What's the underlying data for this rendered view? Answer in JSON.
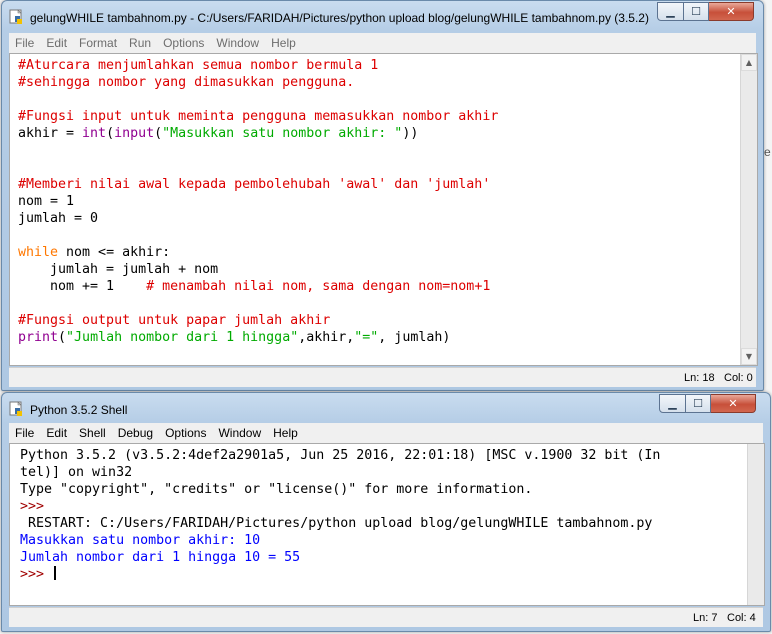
{
  "editor_window": {
    "title": "gelungWHILE tambahnom.py - C:/Users/FARIDAH/Pictures/python upload blog/gelungWHILE tambahnom.py (3.5.2)",
    "menu": [
      "File",
      "Edit",
      "Format",
      "Run",
      "Options",
      "Window",
      "Help"
    ],
    "code_lines": [
      [
        {
          "t": "#Aturcara menjumlahkan semua nombor bermula 1",
          "c": "cmt"
        }
      ],
      [
        {
          "t": "#sehingga nombor yang dimasukkan pengguna.",
          "c": "cmt"
        }
      ],
      [],
      [
        {
          "t": "#Fungsi input untuk meminta pengguna memasukkan nombor akhir",
          "c": "cmt"
        }
      ],
      [
        {
          "t": "akhir = ",
          "c": ""
        },
        {
          "t": "int",
          "c": "bi"
        },
        {
          "t": "(",
          "c": ""
        },
        {
          "t": "input",
          "c": "bi"
        },
        {
          "t": "(",
          "c": ""
        },
        {
          "t": "\"Masukkan satu nombor akhir: \"",
          "c": "str"
        },
        {
          "t": "))",
          "c": ""
        }
      ],
      [],
      [],
      [
        {
          "t": "#Memberi nilai awal kepada pembolehubah 'awal' dan 'jumlah'",
          "c": "cmt"
        }
      ],
      [
        {
          "t": "nom = 1",
          "c": ""
        }
      ],
      [
        {
          "t": "jumlah = 0",
          "c": ""
        }
      ],
      [],
      [
        {
          "t": "while",
          "c": "kw"
        },
        {
          "t": " nom <= akhir:",
          "c": ""
        }
      ],
      [
        {
          "t": "    jumlah = jumlah + nom",
          "c": ""
        }
      ],
      [
        {
          "t": "    nom += 1    ",
          "c": ""
        },
        {
          "t": "# menambah nilai nom, sama dengan nom=nom+1",
          "c": "cmt"
        }
      ],
      [],
      [
        {
          "t": "#Fungsi output untuk papar jumlah akhir",
          "c": "cmt"
        }
      ],
      [
        {
          "t": "print",
          "c": "bi"
        },
        {
          "t": "(",
          "c": ""
        },
        {
          "t": "\"Jumlah nombor dari 1 hingga\"",
          "c": "str"
        },
        {
          "t": ",akhir,",
          "c": ""
        },
        {
          "t": "\"=\"",
          "c": "str"
        },
        {
          "t": ", jumlah)",
          "c": ""
        }
      ]
    ],
    "status": {
      "line": "Ln: 18",
      "col": "Col: 0"
    }
  },
  "shell_window": {
    "title": "Python 3.5.2 Shell",
    "menu": [
      "File",
      "Edit",
      "Shell",
      "Debug",
      "Options",
      "Window",
      "Help"
    ],
    "lines": [
      [
        {
          "t": "Python 3.5.2 (v3.5.2:4def2a2901a5, Jun 25 2016, 22:01:18) [MSC v.1900 32 bit (In",
          "c": ""
        }
      ],
      [
        {
          "t": "tel)] on win32",
          "c": ""
        }
      ],
      [
        {
          "t": "Type \"copyright\", \"credits\" or \"license()\" for more information.",
          "c": ""
        }
      ],
      [
        {
          "t": ">>> ",
          "c": "prompt"
        }
      ],
      [
        {
          "t": " RESTART: C:/Users/FARIDAH/Pictures/python upload blog/gelungWHILE tambahnom.py",
          "c": ""
        }
      ],
      [
        {
          "t": "Masukkan satu nombor akhir: 10",
          "c": "out"
        }
      ],
      [
        {
          "t": "Jumlah nombor dari 1 hingga 10 = 55",
          "c": "out"
        }
      ],
      [
        {
          "t": ">>> ",
          "c": "prompt"
        }
      ]
    ],
    "status": {
      "line": "Ln: 7",
      "col": "Col: 4"
    }
  },
  "icons": {
    "app": "python-idle-icon",
    "minimize": "minimize-icon",
    "maximize": "maximize-icon",
    "close": "close-icon",
    "scroll_up": "scroll-up-arrow-icon",
    "scroll_down": "scroll-down-arrow-icon"
  },
  "glyphs": {
    "minimize": "▁",
    "maximize": "☐",
    "close": "✕",
    "scroll_up": "▲",
    "scroll_down": "▼"
  },
  "colors": {
    "comment": "#dd0000",
    "keyword": "#ff7700",
    "builtin": "#900090",
    "string": "#00aa00",
    "output": "#0000ff",
    "prompt": "#a00000"
  }
}
